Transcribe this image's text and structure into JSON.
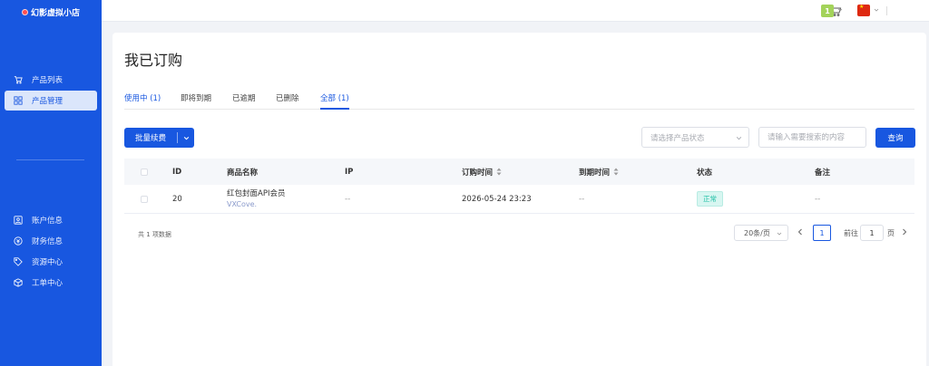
{
  "app": {
    "logo_text": "幻影虚拟小店"
  },
  "sidebar": {
    "items_top": [
      {
        "label": "产品列表",
        "icon": "cart-icon"
      },
      {
        "label": "产品管理",
        "icon": "grid-icon",
        "active": true
      }
    ],
    "items_bottom": [
      {
        "label": "账户信息",
        "icon": "user-card-icon"
      },
      {
        "label": "财务信息",
        "icon": "finance-icon"
      },
      {
        "label": "资源中心",
        "icon": "tag-icon"
      },
      {
        "label": "工单中心",
        "icon": "box-icon"
      }
    ]
  },
  "topbar": {
    "avatar_initial": "1",
    "flag": "china-flag-icon"
  },
  "page": {
    "title": "我已订购"
  },
  "tabs": [
    {
      "label": "使用中 (1)",
      "active": false,
      "accent": true
    },
    {
      "label": "即将到期",
      "active": false
    },
    {
      "label": "已逾期",
      "active": false
    },
    {
      "label": "已删除",
      "active": false
    },
    {
      "label": "全部 (1)",
      "active": true
    }
  ],
  "toolbar": {
    "batch_renew_label": "批量续费",
    "status_placeholder": "请选择产品状态",
    "search_placeholder": "请输入需要搜索的内容",
    "query_label": "查询"
  },
  "table": {
    "headers": {
      "id": "ID",
      "product": "商品名称",
      "ip": "IP",
      "order_time": "订购时间",
      "expire_time": "到期时间",
      "status": "状态",
      "remark": "备注"
    },
    "rows": [
      {
        "id": "20",
        "product_name": "红包封面API会员",
        "product_sub": "VXCove.",
        "ip": "--",
        "order_time": "2026-05-24 23:23",
        "expire_time": "--",
        "status": "正常",
        "remark": "--"
      }
    ]
  },
  "pagination": {
    "total_text": "共 1 项数据",
    "page_size": "20条/页",
    "current_page": "1",
    "goto_label": "前往",
    "goto_value": "1",
    "page_suffix": "页"
  },
  "colors": {
    "primary": "#1857e0",
    "status_ok": "#1fbfa5",
    "sidebar_bg": "#1857e0"
  }
}
